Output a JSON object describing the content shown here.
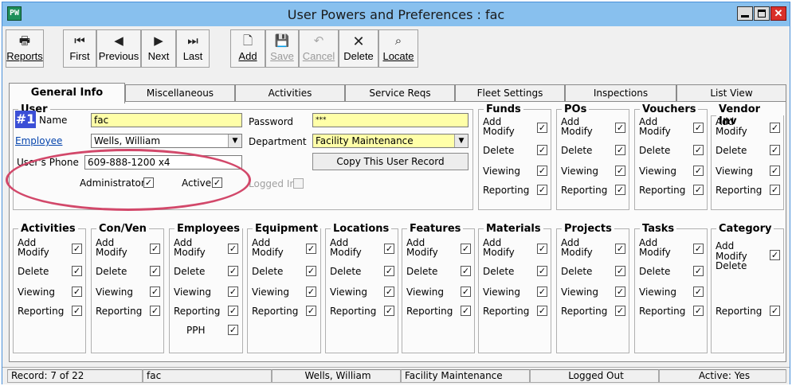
{
  "window": {
    "title": "User Powers and Preferences : fac",
    "app_icon": "PW"
  },
  "toolbar": {
    "reports": "Reports",
    "first": "First",
    "previous": "Previous",
    "next": "Next",
    "last": "Last",
    "add": "Add",
    "save": "Save",
    "cancel": "Cancel",
    "delete": "Delete",
    "locate": "Locate"
  },
  "tabs": [
    "General Info",
    "Miscellaneous",
    "Activities",
    "Service Reqs",
    "Fleet Settings",
    "Inspections",
    "List View"
  ],
  "user": {
    "legend": "User",
    "badge": "#1",
    "name_label": "Name",
    "name_value": "fac",
    "employee_label": "Employee",
    "employee_value": "Wells, William",
    "phone_label": "User's Phone",
    "phone_value": "609-888-1200 x4",
    "admin_label": "Administrator",
    "active_label": "Active",
    "password_label": "Password",
    "password_value": "***",
    "department_label": "Department",
    "department_value": "Facility Maintenance",
    "copy_button": "Copy This User Record",
    "logged_in_label": "Logged In"
  },
  "perm_labels": {
    "add": "Add",
    "modify": "Modify",
    "delete": "Delete",
    "viewing": "Viewing",
    "reporting": "Reporting",
    "pph": "PPH"
  },
  "groups_top": {
    "funds": "Funds",
    "pos": "POs",
    "vouchers": "Vouchers",
    "vendor_inv": "Vendor Inv"
  },
  "groups_bottom": {
    "activities": "Activities",
    "conven": "Con/Ven",
    "employees": "Employees",
    "equipment": "Equipment",
    "locations": "Locations",
    "features": "Features",
    "materials": "Materials",
    "projects": "Projects",
    "tasks": "Tasks",
    "category": "Category"
  },
  "status": {
    "record": "Record: 7 of 22",
    "user": "fac",
    "employee": "Wells, William",
    "department": "Facility Maintenance",
    "login": "Logged Out",
    "active": "Active: Yes"
  },
  "colors": {
    "titlebar": "#88c0ee",
    "required_field": "#ffffa8",
    "highlight_circle": "#d2486a",
    "badge": "#3b4fd6"
  }
}
